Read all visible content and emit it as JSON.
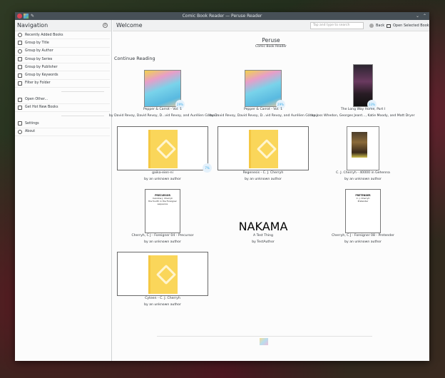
{
  "window": {
    "title": "Comic Book Reader — Peruse Reader"
  },
  "nav": {
    "title": "Navigation",
    "items": [
      {
        "label": "Recently Added Books",
        "icon": "clock-icon"
      },
      {
        "label": "Group by Title",
        "icon": "book-icon"
      },
      {
        "label": "Group by Author",
        "icon": "user-icon"
      },
      {
        "label": "Group by Series",
        "icon": "series-icon"
      },
      {
        "label": "Group by Publisher",
        "icon": "publisher-icon"
      },
      {
        "label": "Group by Keywords",
        "icon": "tag-icon"
      },
      {
        "label": "Filter by Folder",
        "icon": "folder-icon"
      }
    ],
    "items2": [
      {
        "label": "Open Other...",
        "icon": "folder-open-icon"
      },
      {
        "label": "Get Hot New Books",
        "icon": "download-icon"
      }
    ],
    "items3": [
      {
        "label": "Settings",
        "icon": "settings-icon"
      },
      {
        "label": "About",
        "icon": "info-icon"
      }
    ]
  },
  "header": {
    "title": "Welcome",
    "search_placeholder": "Tap and type to search",
    "back": "Back",
    "open_selected": "Open Selected Book"
  },
  "app": {
    "name": "Peruse",
    "subtitle": "Comic Book Reader"
  },
  "section": "Continue Reading",
  "books": [
    {
      "title": "Pepper & Carrot - Vol. 1",
      "author": "by David Revoy, David Revoy, D...vid Revoy, and Aurélien Gâteau",
      "cover": "art",
      "progress": "29%"
    },
    {
      "title": "Pepper & Carrot - Vol. 1",
      "author": "by David Revoy, David Revoy, D...vid Revoy, and Aurélien Gâteau",
      "cover": "art",
      "progress": "29%"
    },
    {
      "title": "The Long Way Home, Part I",
      "author": "by Joss Whedon, Georges Jeant..., Katie Moody, and Matt Dryer",
      "cover": "portrait",
      "progress": "33%"
    },
    {
      "title": "gaika-eien-ni",
      "author": "by an unknown author",
      "cover": "epub",
      "progress": "7%"
    },
    {
      "title": "Regenesis - C. J. Cherryh",
      "author": "by an unknown author",
      "cover": "epub",
      "progress": ""
    },
    {
      "title": "C. J. Cherryh - 40000 in Gehenna",
      "author": "by an unknown author",
      "cover": "small",
      "progress": ""
    },
    {
      "title": "Cherryh, C J - Foreigner 04 - Precursor",
      "author": "by an unknown author",
      "cover": "doc",
      "progress": "",
      "cover_text": [
        "PRECURSOR",
        "Caroline J. Cherryh",
        "the fourth in the Foreigner sequence"
      ]
    },
    {
      "title": "A Test Thing",
      "author": "by TestAuthor",
      "cover": "nakama",
      "progress": "",
      "cover_text": [
        "NAKAMA"
      ]
    },
    {
      "title": "Cherryh, C J - Foreigner 08 - Pretender",
      "author": "by an unknown author",
      "cover": "doc",
      "progress": "",
      "cover_text": [
        "PRETENDER",
        "C. J. Cherryh",
        "Pretender"
      ]
    },
    {
      "title": "Cyteen - C. J. Cherryh",
      "author": "by an unknown author",
      "cover": "epub",
      "progress": ""
    }
  ]
}
